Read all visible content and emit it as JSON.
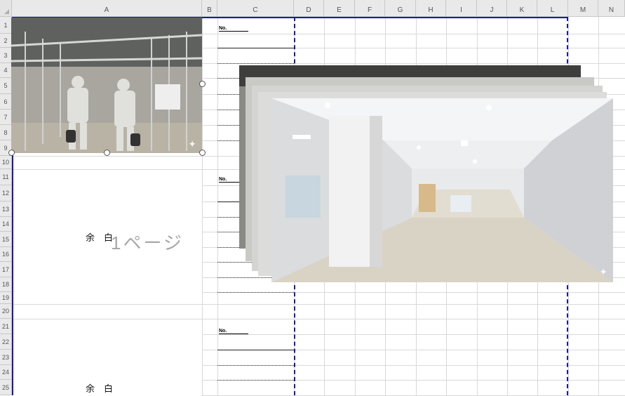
{
  "columns": [
    "A",
    "B",
    "C",
    "D",
    "E",
    "F",
    "G",
    "H",
    "I",
    "J",
    "K",
    "L",
    "M",
    "N"
  ],
  "rows": [
    "1",
    "2",
    "3",
    "4",
    "5",
    "6",
    "7",
    "8",
    "9",
    "10",
    "11",
    "12",
    "13",
    "14",
    "15",
    "16",
    "17",
    "18",
    "19",
    "20",
    "21",
    "22",
    "23",
    "24",
    "25"
  ],
  "cells": {
    "no_label_1": "No.",
    "no_label_2": "No.",
    "no_label_3": "No.",
    "margin_text_1": "余　白",
    "margin_text_2": "余　白"
  },
  "watermark": "1ページ",
  "images": {
    "construction_photo": "construction-site-photo",
    "office_photo_front": "office-interior-photo",
    "office_photo_back": "office-interior-photo"
  },
  "icons": {
    "corner": "select-all-icon",
    "sparkle": "ai-sparkle-icon"
  },
  "colors": {
    "page_break": "#1a1aa6",
    "header_bg": "#e9e9e9",
    "grid": "#d9d9d9"
  }
}
